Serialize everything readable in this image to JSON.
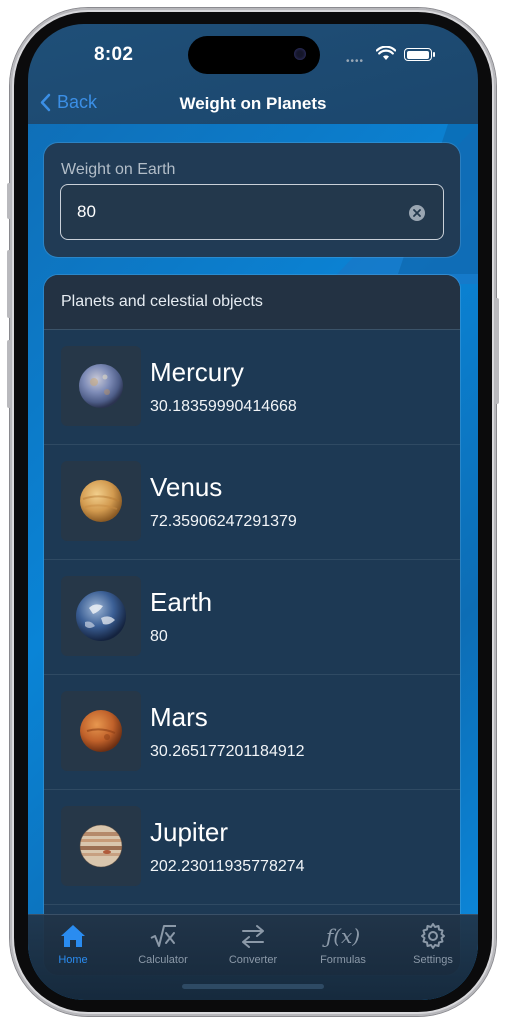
{
  "status_bar": {
    "time": "8:02",
    "signal_dots": "••••"
  },
  "nav": {
    "back_label": "Back",
    "title": "Weight on Planets"
  },
  "weight_input": {
    "label": "Weight on Earth",
    "value": "80"
  },
  "list": {
    "header": "Planets and celestial objects",
    "items": [
      {
        "name": "Mercury",
        "weight": "30.18359990414668"
      },
      {
        "name": "Venus",
        "weight": "72.35906247291379"
      },
      {
        "name": "Earth",
        "weight": "80"
      },
      {
        "name": "Mars",
        "weight": "30.265177201184912"
      },
      {
        "name": "Jupiter",
        "weight": "202.23011935778274"
      }
    ]
  },
  "tabs": [
    {
      "label": "Home",
      "icon": "house-icon",
      "active": true
    },
    {
      "label": "Calculator",
      "icon": "square-root-icon",
      "active": false
    },
    {
      "label": "Converter",
      "icon": "arrows-swap-icon",
      "active": false
    },
    {
      "label": "Formulas",
      "icon": "function-icon",
      "active": false
    },
    {
      "label": "Settings",
      "icon": "gear-icon",
      "active": false
    }
  ],
  "colors": {
    "accent": "#2a8cf0",
    "background": "#0a84d6",
    "card": "#1d3954"
  }
}
